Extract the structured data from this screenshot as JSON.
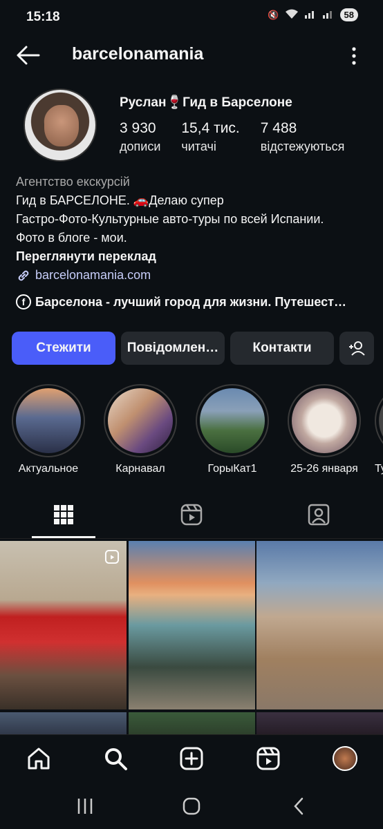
{
  "status": {
    "time": "15:18",
    "battery": "58"
  },
  "header": {
    "username": "barcelonamania"
  },
  "profile": {
    "full_name": "Руслан🍷Гид в Барселоне",
    "stats": [
      {
        "value": "3 930",
        "label": "дописи"
      },
      {
        "value": "15,4 тис.",
        "label": "читачі"
      },
      {
        "value": "7 488",
        "label": "відстежуються"
      }
    ],
    "category": "Агентство екскурсій",
    "bio_lines": [
      "Гид в БАРСЕЛОНЕ. 🚗Делаю супер",
      "Гастро-Фото-Культурные авто-туры по всей Испании.",
      "Фото в блоге - мои."
    ],
    "translate": "Переглянути переклад",
    "link": "barcelonamania.com",
    "facebook": "Барселона - лучший город для жизни. Путешест…"
  },
  "buttons": {
    "follow": "Стежити",
    "message": "Повідомлен…",
    "contacts": "Контакти"
  },
  "highlights": [
    {
      "label": "Актуальное"
    },
    {
      "label": "Карнавал"
    },
    {
      "label": "ГорыКат1"
    },
    {
      "label": "25-26 января"
    },
    {
      "label": "Ту"
    }
  ]
}
